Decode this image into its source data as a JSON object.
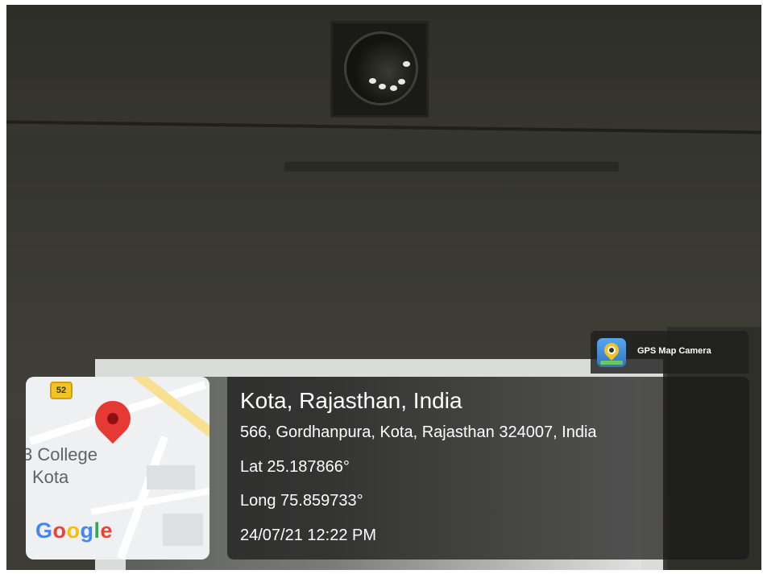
{
  "badge": {
    "label": "GPS Map Camera",
    "icon": "gps-map-camera-app-icon"
  },
  "map": {
    "shield_number": "52",
    "place_label_1": "3 College",
    "place_label_2": "Kota",
    "logo_text": "Google",
    "pin_color": "#e53935"
  },
  "location": {
    "title": "Kota, Rajasthan, India",
    "address": "566, Gordhanpura, Kota, Rajasthan 324007, India",
    "latitude": "Lat 25.187866°",
    "longitude": "Long 75.859733°",
    "datetime": "24/07/21 12:22 PM"
  },
  "colors": {
    "overlay": "#191919",
    "text": "#ffffff"
  }
}
